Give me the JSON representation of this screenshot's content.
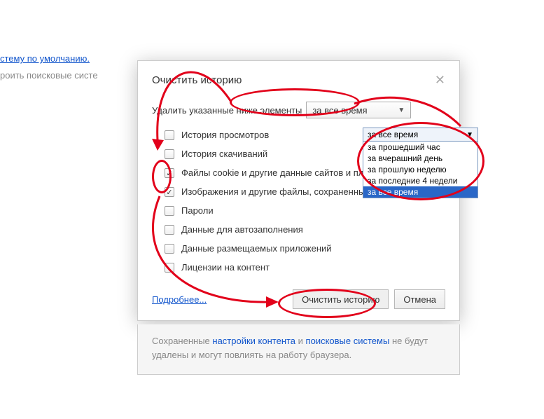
{
  "bg": {
    "link1": "стему по умолчанию.",
    "text1": "роить поисковые систе"
  },
  "dialog": {
    "title": "Очистить историю",
    "prompt": "Удалить указанные ниже элементы",
    "dropdown_selected": "за все время",
    "checkboxes": [
      {
        "label": "История просмотров",
        "checked": false
      },
      {
        "label": "История скачиваний",
        "checked": false
      },
      {
        "label": "Файлы cookie и другие данные сайтов и плагинов",
        "checked": true
      },
      {
        "label": "Изображения и другие файлы, сохраненные в кеше",
        "checked": true
      },
      {
        "label": "Пароли",
        "checked": false
      },
      {
        "label": "Данные для автозаполнения",
        "checked": false
      },
      {
        "label": "Данные размещаемых приложений",
        "checked": false
      },
      {
        "label": "Лицензии на контент",
        "checked": false
      }
    ],
    "more_link": "Подробнее...",
    "btn_clear": "Очистить историю",
    "btn_cancel": "Отмена"
  },
  "dropdown_options": [
    "за прошедший час",
    "за вчерашний день",
    "за прошлую неделю",
    "за последние 4 недели",
    "за все время"
  ],
  "footer": {
    "p1": "Сохраненные ",
    "l1": "настройки контента",
    "p2": " и ",
    "l2": "поисковые системы",
    "p3": " не будут удалены и могут повлиять на работу браузера."
  }
}
